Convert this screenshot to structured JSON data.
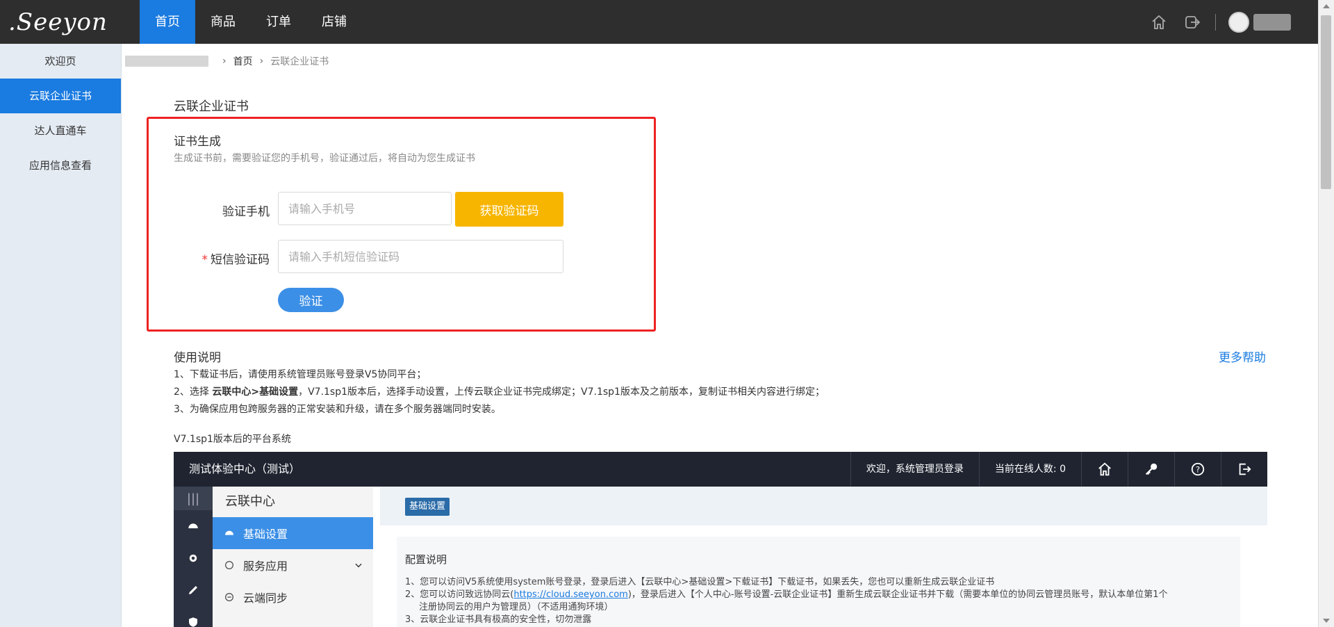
{
  "brand": {
    "logo_text": ".Seeyon"
  },
  "topnav": {
    "items": [
      "首页",
      "商品",
      "订单",
      "店铺"
    ],
    "active_index": 0
  },
  "sidebar": {
    "items": [
      "欢迎页",
      "云联企业证书",
      "达人直通车",
      "应用信息查看"
    ],
    "active_index": 1
  },
  "breadcrumb": {
    "items": [
      "首页",
      "云联企业证书"
    ]
  },
  "page": {
    "title": "云联企业证书"
  },
  "cert": {
    "title": "证书生成",
    "desc": "生成证书前，需要验证您的手机号，验证通过后，将自动为您生成证书",
    "phone_label": "验证手机",
    "phone_placeholder": "请输入手机号",
    "get_code_button": "获取验证码",
    "sms_required_mark": "*",
    "sms_label": "短信验证码",
    "sms_placeholder": "请输入手机短信验证码",
    "verify_button": "验证"
  },
  "usage": {
    "title": "使用说明",
    "more_help": "更多帮助",
    "line1": "1、下载证书后，请使用系统管理员账号登录V5协同平台；",
    "line2_prefix": "2、选择 ",
    "line2_bold": "云联中心>基础设置",
    "line2_suffix": "，V7.1sp1版本后，选择手动设置，上传云联企业证书完成绑定；V7.1sp1版本及之前版本，复制证书相关内容进行绑定；",
    "line3": "3、为确保应用包跨服务器的正常安装和升级，请在多个服务器端同时安装。",
    "v7_label": "V7.1sp1版本后的平台系统"
  },
  "embedded": {
    "title": "测试体验中心（测试）",
    "welcome": "欢迎，系统管理员登录",
    "online": "当前在线人数: 0",
    "rail_toggle": "|||",
    "menu_head": "云联中心",
    "menu_items": [
      "基础设置",
      "服务应用",
      "云端同步"
    ],
    "tab": "基础设置",
    "card_title": "配置说明",
    "card_line1": "1、您可以访问V5系统使用system账号登录，登录后进入【云联中心>基础设置>下载证书】下载证书，如果丢失，您也可以重新生成云联企业证书",
    "card_line2_prefix": "2、您可以访问致远协同云(",
    "card_line2_link": "https://cloud.seeyon.com",
    "card_line2_suffix": ")，登录后进入【个人中心-账号设置-云联企业证书】重新生成云联企业证书并下载（需要本单位的协同云管理员账号，默认本单位第1个",
    "card_line2_cont": "注册协同云的用户为管理员）（不适用通狗环境）",
    "card_line3": "3、云联企业证书具有极高的安全性，切勿泄露"
  },
  "colors": {
    "primary": "#1a7be0",
    "warning": "#f7b500",
    "highlight": "#ee2222",
    "topbar": "#2e2e2e"
  }
}
